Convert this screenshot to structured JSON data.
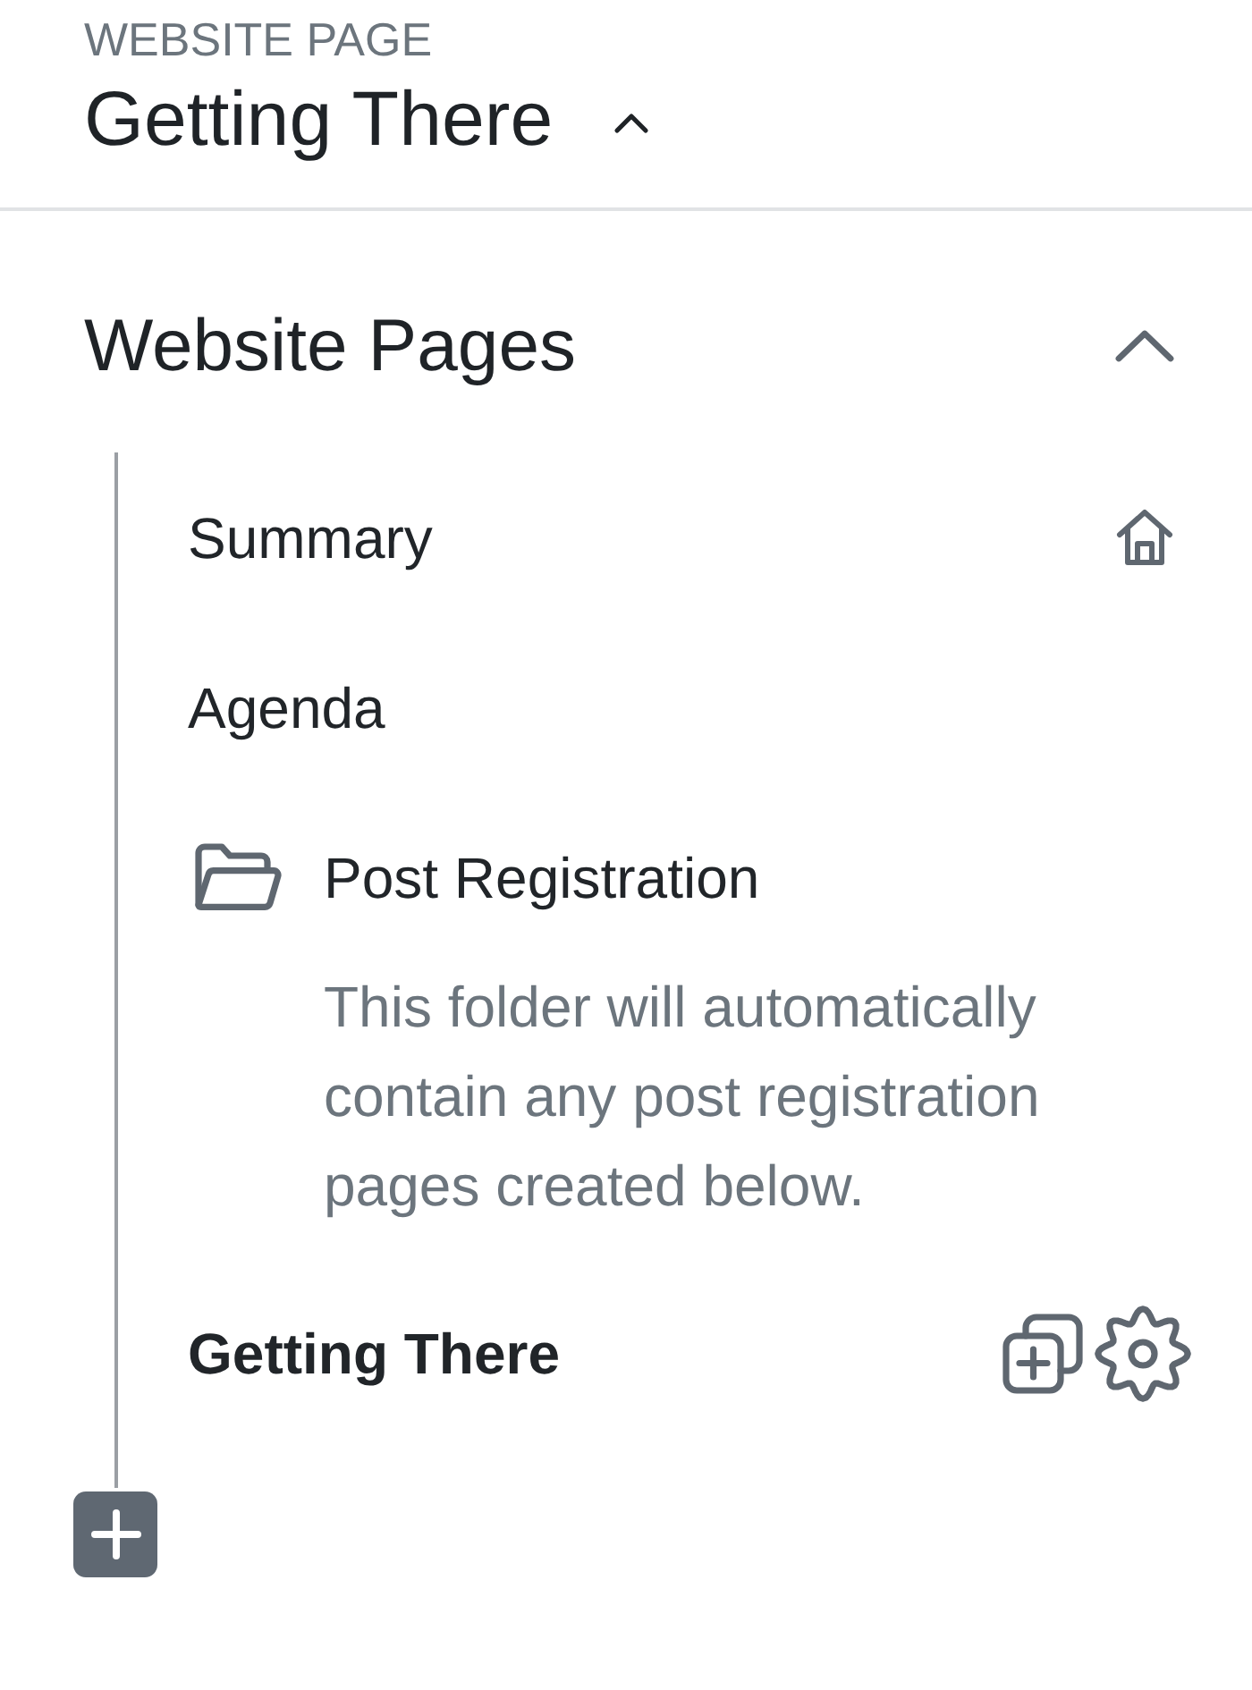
{
  "header": {
    "label": "WEBSITE PAGE",
    "title": "Getting There",
    "expanded": true
  },
  "section": {
    "title": "Website Pages",
    "expanded": true,
    "pages": [
      {
        "kind": "page",
        "label": "Summary",
        "home": true,
        "selected": false
      },
      {
        "kind": "page",
        "label": "Agenda",
        "home": false,
        "selected": false
      },
      {
        "kind": "folder",
        "label": "Post Registration",
        "description": "This folder will automatically contain any post registration pages created below.",
        "selected": false
      },
      {
        "kind": "page",
        "label": "Getting There",
        "home": false,
        "selected": true
      }
    ]
  }
}
